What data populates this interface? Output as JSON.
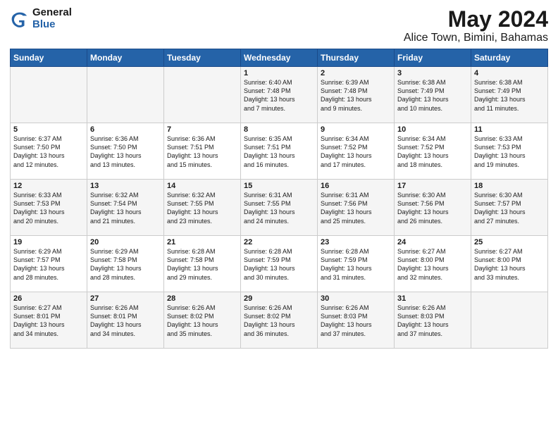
{
  "logo": {
    "general": "General",
    "blue": "Blue"
  },
  "title": "May 2024",
  "subtitle": "Alice Town, Bimini, Bahamas",
  "headers": [
    "Sunday",
    "Monday",
    "Tuesday",
    "Wednesday",
    "Thursday",
    "Friday",
    "Saturday"
  ],
  "weeks": [
    [
      {
        "day": "",
        "info": ""
      },
      {
        "day": "",
        "info": ""
      },
      {
        "day": "",
        "info": ""
      },
      {
        "day": "1",
        "info": "Sunrise: 6:40 AM\nSunset: 7:48 PM\nDaylight: 13 hours\nand 7 minutes."
      },
      {
        "day": "2",
        "info": "Sunrise: 6:39 AM\nSunset: 7:48 PM\nDaylight: 13 hours\nand 9 minutes."
      },
      {
        "day": "3",
        "info": "Sunrise: 6:38 AM\nSunset: 7:49 PM\nDaylight: 13 hours\nand 10 minutes."
      },
      {
        "day": "4",
        "info": "Sunrise: 6:38 AM\nSunset: 7:49 PM\nDaylight: 13 hours\nand 11 minutes."
      }
    ],
    [
      {
        "day": "5",
        "info": "Sunrise: 6:37 AM\nSunset: 7:50 PM\nDaylight: 13 hours\nand 12 minutes."
      },
      {
        "day": "6",
        "info": "Sunrise: 6:36 AM\nSunset: 7:50 PM\nDaylight: 13 hours\nand 13 minutes."
      },
      {
        "day": "7",
        "info": "Sunrise: 6:36 AM\nSunset: 7:51 PM\nDaylight: 13 hours\nand 15 minutes."
      },
      {
        "day": "8",
        "info": "Sunrise: 6:35 AM\nSunset: 7:51 PM\nDaylight: 13 hours\nand 16 minutes."
      },
      {
        "day": "9",
        "info": "Sunrise: 6:34 AM\nSunset: 7:52 PM\nDaylight: 13 hours\nand 17 minutes."
      },
      {
        "day": "10",
        "info": "Sunrise: 6:34 AM\nSunset: 7:52 PM\nDaylight: 13 hours\nand 18 minutes."
      },
      {
        "day": "11",
        "info": "Sunrise: 6:33 AM\nSunset: 7:53 PM\nDaylight: 13 hours\nand 19 minutes."
      }
    ],
    [
      {
        "day": "12",
        "info": "Sunrise: 6:33 AM\nSunset: 7:53 PM\nDaylight: 13 hours\nand 20 minutes."
      },
      {
        "day": "13",
        "info": "Sunrise: 6:32 AM\nSunset: 7:54 PM\nDaylight: 13 hours\nand 21 minutes."
      },
      {
        "day": "14",
        "info": "Sunrise: 6:32 AM\nSunset: 7:55 PM\nDaylight: 13 hours\nand 23 minutes."
      },
      {
        "day": "15",
        "info": "Sunrise: 6:31 AM\nSunset: 7:55 PM\nDaylight: 13 hours\nand 24 minutes."
      },
      {
        "day": "16",
        "info": "Sunrise: 6:31 AM\nSunset: 7:56 PM\nDaylight: 13 hours\nand 25 minutes."
      },
      {
        "day": "17",
        "info": "Sunrise: 6:30 AM\nSunset: 7:56 PM\nDaylight: 13 hours\nand 26 minutes."
      },
      {
        "day": "18",
        "info": "Sunrise: 6:30 AM\nSunset: 7:57 PM\nDaylight: 13 hours\nand 27 minutes."
      }
    ],
    [
      {
        "day": "19",
        "info": "Sunrise: 6:29 AM\nSunset: 7:57 PM\nDaylight: 13 hours\nand 28 minutes."
      },
      {
        "day": "20",
        "info": "Sunrise: 6:29 AM\nSunset: 7:58 PM\nDaylight: 13 hours\nand 28 minutes."
      },
      {
        "day": "21",
        "info": "Sunrise: 6:28 AM\nSunset: 7:58 PM\nDaylight: 13 hours\nand 29 minutes."
      },
      {
        "day": "22",
        "info": "Sunrise: 6:28 AM\nSunset: 7:59 PM\nDaylight: 13 hours\nand 30 minutes."
      },
      {
        "day": "23",
        "info": "Sunrise: 6:28 AM\nSunset: 7:59 PM\nDaylight: 13 hours\nand 31 minutes."
      },
      {
        "day": "24",
        "info": "Sunrise: 6:27 AM\nSunset: 8:00 PM\nDaylight: 13 hours\nand 32 minutes."
      },
      {
        "day": "25",
        "info": "Sunrise: 6:27 AM\nSunset: 8:00 PM\nDaylight: 13 hours\nand 33 minutes."
      }
    ],
    [
      {
        "day": "26",
        "info": "Sunrise: 6:27 AM\nSunset: 8:01 PM\nDaylight: 13 hours\nand 34 minutes."
      },
      {
        "day": "27",
        "info": "Sunrise: 6:26 AM\nSunset: 8:01 PM\nDaylight: 13 hours\nand 34 minutes."
      },
      {
        "day": "28",
        "info": "Sunrise: 6:26 AM\nSunset: 8:02 PM\nDaylight: 13 hours\nand 35 minutes."
      },
      {
        "day": "29",
        "info": "Sunrise: 6:26 AM\nSunset: 8:02 PM\nDaylight: 13 hours\nand 36 minutes."
      },
      {
        "day": "30",
        "info": "Sunrise: 6:26 AM\nSunset: 8:03 PM\nDaylight: 13 hours\nand 37 minutes."
      },
      {
        "day": "31",
        "info": "Sunrise: 6:26 AM\nSunset: 8:03 PM\nDaylight: 13 hours\nand 37 minutes."
      },
      {
        "day": "",
        "info": ""
      }
    ]
  ]
}
